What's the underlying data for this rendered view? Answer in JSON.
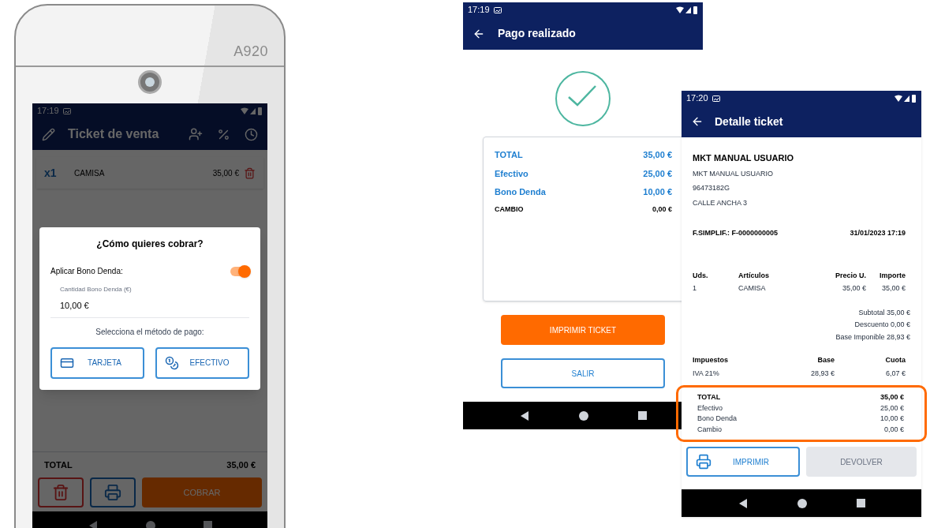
{
  "device": {
    "model": "A920",
    "screen": {
      "status_bar": {
        "time": "17:19"
      },
      "app_bar": {
        "title": "Ticket de venta"
      },
      "items": [
        {
          "qty": "x1",
          "name": "CAMISA",
          "price": "35,00 €"
        }
      ],
      "total": {
        "label": "TOTAL",
        "value": "35,00 €"
      },
      "actions": [
        {
          "kind": "delete"
        },
        {
          "kind": "print"
        },
        {
          "kind": "primary",
          "label": "COBRAR"
        }
      ],
      "dialog": {
        "title": "¿Cómo quieres cobrar?",
        "toggle": {
          "label": "Aplicar Bono Denda:",
          "on": true
        },
        "field": {
          "label": "Cantidad Bono Denda (€)",
          "value": "10,00 €"
        },
        "prompt": "Selecciona el método de pago:",
        "buttons": [
          {
            "kind": "card",
            "label": "TARJETA"
          },
          {
            "kind": "cash",
            "label": "EFECTIVO"
          }
        ]
      }
    }
  },
  "payment_screen": {
    "status_bar": {
      "time": "17:19"
    },
    "app_bar": {
      "title": "Pago realizado"
    },
    "summary": [
      {
        "label": "TOTAL",
        "value": "35,00 €",
        "highlight": true
      },
      {
        "label": "Efectivo",
        "value": "25,00 €",
        "highlight": true
      },
      {
        "label": "Bono Denda",
        "value": "10,00 €",
        "highlight": true
      },
      {
        "label": "CAMBIO",
        "value": "0,00 €",
        "highlight": false
      }
    ],
    "buttons": [
      {
        "kind": "filled",
        "label": "IMPRIMIR TICKET"
      },
      {
        "kind": "outlined",
        "label": "SALIR"
      }
    ]
  },
  "ticket_screen": {
    "status_bar": {
      "time": "17:20"
    },
    "app_bar": {
      "title": "Detalle ticket"
    },
    "company": "MKT MANUAL USUARIO",
    "address_lines": [
      "MKT MANUAL USUARIO",
      "96473182G",
      "CALLE ANCHA 3"
    ],
    "invoice": {
      "number": "F.SIMPLIF.: F-0000000005",
      "date": "31/01/2023 17:19"
    },
    "items": {
      "columns": [
        "Uds.",
        "Artículos",
        "Precio U.",
        "Importe"
      ],
      "rows": [
        [
          "1",
          "CAMISA",
          "35,00 €",
          "35,00 €"
        ]
      ]
    },
    "totals": [
      "Subtotal 35,00 €",
      "Descuento 0,00 €",
      "Base Imponible 28,93 €"
    ],
    "taxes": {
      "columns": [
        "Impuestos",
        "Base",
        "Cuota"
      ],
      "rows": [
        [
          "IVA 21%",
          "28,93 €",
          "6,07 €"
        ]
      ]
    },
    "payment": {
      "highlighted": true,
      "rows": [
        {
          "label": "TOTAL",
          "value": "35,00 €",
          "bold": true
        },
        {
          "label": "Efectivo",
          "value": "25,00 €",
          "bold": false
        },
        {
          "label": "Bono Denda",
          "value": "10,00 €",
          "bold": false
        },
        {
          "label": "Cambio",
          "value": "0,00 €",
          "bold": false
        }
      ]
    },
    "buttons": [
      {
        "kind": "print",
        "label": "IMPRIMIR",
        "disabled": false
      },
      {
        "kind": "plain",
        "label": "DEVOLVER",
        "disabled": true
      }
    ]
  }
}
